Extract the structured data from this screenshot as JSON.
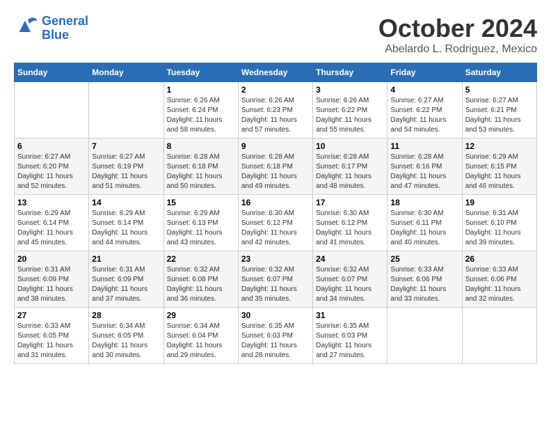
{
  "header": {
    "logo_line1": "General",
    "logo_line2": "Blue",
    "month": "October 2024",
    "location": "Abelardo L. Rodriguez, Mexico"
  },
  "weekdays": [
    "Sunday",
    "Monday",
    "Tuesday",
    "Wednesday",
    "Thursday",
    "Friday",
    "Saturday"
  ],
  "weeks": [
    [
      {
        "day": "",
        "info": ""
      },
      {
        "day": "",
        "info": ""
      },
      {
        "day": "1",
        "info": "Sunrise: 6:26 AM\nSunset: 6:24 PM\nDaylight: 11 hours and 58 minutes."
      },
      {
        "day": "2",
        "info": "Sunrise: 6:26 AM\nSunset: 6:23 PM\nDaylight: 11 hours and 57 minutes."
      },
      {
        "day": "3",
        "info": "Sunrise: 6:26 AM\nSunset: 6:22 PM\nDaylight: 11 hours and 55 minutes."
      },
      {
        "day": "4",
        "info": "Sunrise: 6:27 AM\nSunset: 6:22 PM\nDaylight: 11 hours and 54 minutes."
      },
      {
        "day": "5",
        "info": "Sunrise: 6:27 AM\nSunset: 6:21 PM\nDaylight: 11 hours and 53 minutes."
      }
    ],
    [
      {
        "day": "6",
        "info": "Sunrise: 6:27 AM\nSunset: 6:20 PM\nDaylight: 11 hours and 52 minutes."
      },
      {
        "day": "7",
        "info": "Sunrise: 6:27 AM\nSunset: 6:19 PM\nDaylight: 11 hours and 51 minutes."
      },
      {
        "day": "8",
        "info": "Sunrise: 6:28 AM\nSunset: 6:18 PM\nDaylight: 11 hours and 50 minutes."
      },
      {
        "day": "9",
        "info": "Sunrise: 6:28 AM\nSunset: 6:18 PM\nDaylight: 11 hours and 49 minutes."
      },
      {
        "day": "10",
        "info": "Sunrise: 6:28 AM\nSunset: 6:17 PM\nDaylight: 11 hours and 48 minutes."
      },
      {
        "day": "11",
        "info": "Sunrise: 6:28 AM\nSunset: 6:16 PM\nDaylight: 11 hours and 47 minutes."
      },
      {
        "day": "12",
        "info": "Sunrise: 6:29 AM\nSunset: 6:15 PM\nDaylight: 11 hours and 46 minutes."
      }
    ],
    [
      {
        "day": "13",
        "info": "Sunrise: 6:29 AM\nSunset: 6:14 PM\nDaylight: 11 hours and 45 minutes."
      },
      {
        "day": "14",
        "info": "Sunrise: 6:29 AM\nSunset: 6:14 PM\nDaylight: 11 hours and 44 minutes."
      },
      {
        "day": "15",
        "info": "Sunrise: 6:29 AM\nSunset: 6:13 PM\nDaylight: 11 hours and 43 minutes."
      },
      {
        "day": "16",
        "info": "Sunrise: 6:30 AM\nSunset: 6:12 PM\nDaylight: 11 hours and 42 minutes."
      },
      {
        "day": "17",
        "info": "Sunrise: 6:30 AM\nSunset: 6:12 PM\nDaylight: 11 hours and 41 minutes."
      },
      {
        "day": "18",
        "info": "Sunrise: 6:30 AM\nSunset: 6:11 PM\nDaylight: 11 hours and 40 minutes."
      },
      {
        "day": "19",
        "info": "Sunrise: 6:31 AM\nSunset: 6:10 PM\nDaylight: 11 hours and 39 minutes."
      }
    ],
    [
      {
        "day": "20",
        "info": "Sunrise: 6:31 AM\nSunset: 6:09 PM\nDaylight: 11 hours and 38 minutes."
      },
      {
        "day": "21",
        "info": "Sunrise: 6:31 AM\nSunset: 6:09 PM\nDaylight: 11 hours and 37 minutes."
      },
      {
        "day": "22",
        "info": "Sunrise: 6:32 AM\nSunset: 6:08 PM\nDaylight: 11 hours and 36 minutes."
      },
      {
        "day": "23",
        "info": "Sunrise: 6:32 AM\nSunset: 6:07 PM\nDaylight: 11 hours and 35 minutes."
      },
      {
        "day": "24",
        "info": "Sunrise: 6:32 AM\nSunset: 6:07 PM\nDaylight: 11 hours and 34 minutes."
      },
      {
        "day": "25",
        "info": "Sunrise: 6:33 AM\nSunset: 6:06 PM\nDaylight: 11 hours and 33 minutes."
      },
      {
        "day": "26",
        "info": "Sunrise: 6:33 AM\nSunset: 6:06 PM\nDaylight: 11 hours and 32 minutes."
      }
    ],
    [
      {
        "day": "27",
        "info": "Sunrise: 6:33 AM\nSunset: 6:05 PM\nDaylight: 11 hours and 31 minutes."
      },
      {
        "day": "28",
        "info": "Sunrise: 6:34 AM\nSunset: 6:05 PM\nDaylight: 11 hours and 30 minutes."
      },
      {
        "day": "29",
        "info": "Sunrise: 6:34 AM\nSunset: 6:04 PM\nDaylight: 11 hours and 29 minutes."
      },
      {
        "day": "30",
        "info": "Sunrise: 6:35 AM\nSunset: 6:03 PM\nDaylight: 11 hours and 28 minutes."
      },
      {
        "day": "31",
        "info": "Sunrise: 6:35 AM\nSunset: 6:03 PM\nDaylight: 11 hours and 27 minutes."
      },
      {
        "day": "",
        "info": ""
      },
      {
        "day": "",
        "info": ""
      }
    ]
  ]
}
